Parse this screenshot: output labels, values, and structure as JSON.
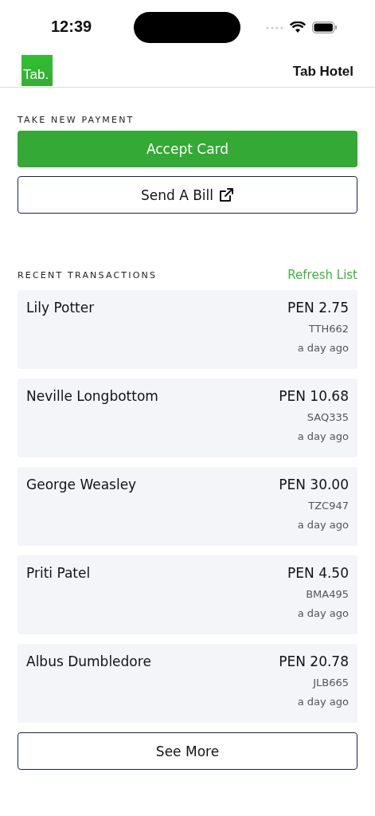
{
  "status_bar": {
    "time": "12:39"
  },
  "header": {
    "logo": "Tab.",
    "title": "Tab Hotel"
  },
  "payment": {
    "heading": "TAKE NEW PAYMENT",
    "accept_button": "Accept Card",
    "bill_button": "Send A Bill"
  },
  "recent": {
    "heading": "RECENT TRANSACTIONS",
    "refresh": "Refresh List",
    "transactions": [
      {
        "name": "Lily Potter",
        "amount": "PEN 2.75",
        "code": "TTH662",
        "time": "a day ago"
      },
      {
        "name": "Neville Longbottom",
        "amount": "PEN 10.68",
        "code": "SAQ335",
        "time": "a day ago"
      },
      {
        "name": "George Weasley",
        "amount": "PEN 30.00",
        "code": "TZC947",
        "time": "a day ago"
      },
      {
        "name": "Priti Patel",
        "amount": "PEN 4.50",
        "code": "BMA495",
        "time": "a day ago"
      },
      {
        "name": "Albus Dumbledore",
        "amount": "PEN 20.78",
        "code": "JLB665",
        "time": "a day ago"
      }
    ],
    "see_more": "See More"
  }
}
